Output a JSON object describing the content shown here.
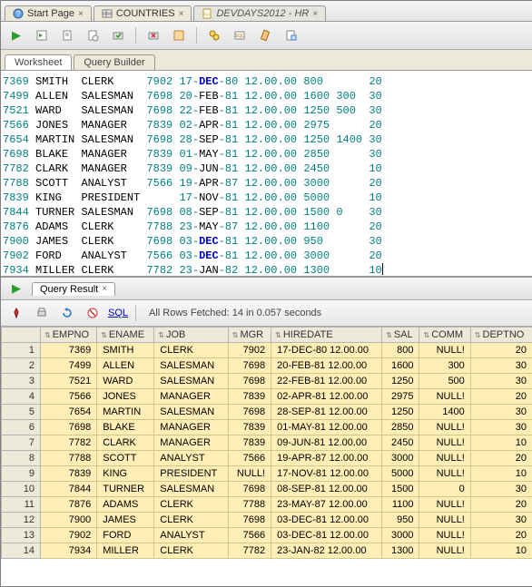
{
  "tabs": {
    "start": "Start Page",
    "countries": "COUNTRIES",
    "devdays": "DEVDAYS2012 - HR"
  },
  "sub_tabs": {
    "worksheet": "Worksheet",
    "query_builder": "Query Builder"
  },
  "editor_rows": [
    {
      "empno": "7369",
      "ename": "SMITH",
      "job": "CLERK",
      "mgr": "7902",
      "hiredate_pre": "17-",
      "hiredate_mon": "DEC",
      "hiredate_post": "-80",
      "time": "12.00.00",
      "sal": "800",
      "comm": "",
      "deptno": "20"
    },
    {
      "empno": "7499",
      "ename": "ALLEN",
      "job": "SALESMAN",
      "mgr": "7698",
      "hiredate_pre": "20-",
      "hiredate_mon": "FEB",
      "hiredate_post": "-81",
      "time": "12.00.00",
      "sal": "1600",
      "comm": "300",
      "deptno": "30"
    },
    {
      "empno": "7521",
      "ename": "WARD",
      "job": "SALESMAN",
      "mgr": "7698",
      "hiredate_pre": "22-",
      "hiredate_mon": "FEB",
      "hiredate_post": "-81",
      "time": "12.00.00",
      "sal": "1250",
      "comm": "500",
      "deptno": "30"
    },
    {
      "empno": "7566",
      "ename": "JONES",
      "job": "MANAGER",
      "mgr": "7839",
      "hiredate_pre": "02-",
      "hiredate_mon": "APR",
      "hiredate_post": "-81",
      "time": "12.00.00",
      "sal": "2975",
      "comm": "",
      "deptno": "20"
    },
    {
      "empno": "7654",
      "ename": "MARTIN",
      "job": "SALESMAN",
      "mgr": "7698",
      "hiredate_pre": "28-",
      "hiredate_mon": "SEP",
      "hiredate_post": "-81",
      "time": "12.00.00",
      "sal": "1250",
      "comm": "1400",
      "deptno": "30"
    },
    {
      "empno": "7698",
      "ename": "BLAKE",
      "job": "MANAGER",
      "mgr": "7839",
      "hiredate_pre": "01-",
      "hiredate_mon": "MAY",
      "hiredate_post": "-81",
      "time": "12.00.00",
      "sal": "2850",
      "comm": "",
      "deptno": "30"
    },
    {
      "empno": "7782",
      "ename": "CLARK",
      "job": "MANAGER",
      "mgr": "7839",
      "hiredate_pre": "09-",
      "hiredate_mon": "JUN",
      "hiredate_post": "-81",
      "time": "12.00.00",
      "sal": "2450",
      "comm": "",
      "deptno": "10"
    },
    {
      "empno": "7788",
      "ename": "SCOTT",
      "job": "ANALYST",
      "mgr": "7566",
      "hiredate_pre": "19-",
      "hiredate_mon": "APR",
      "hiredate_post": "-87",
      "time": "12.00.00",
      "sal": "3000",
      "comm": "",
      "deptno": "20"
    },
    {
      "empno": "7839",
      "ename": "KING",
      "job": "PRESIDENT",
      "mgr": "",
      "hiredate_pre": "17-",
      "hiredate_mon": "NOV",
      "hiredate_post": "-81",
      "time": "12.00.00",
      "sal": "5000",
      "comm": "",
      "deptno": "10"
    },
    {
      "empno": "7844",
      "ename": "TURNER",
      "job": "SALESMAN",
      "mgr": "7698",
      "hiredate_pre": "08-",
      "hiredate_mon": "SEP",
      "hiredate_post": "-81",
      "time": "12.00.00",
      "sal": "1500",
      "comm": "0",
      "deptno": "30"
    },
    {
      "empno": "7876",
      "ename": "ADAMS",
      "job": "CLERK",
      "mgr": "7788",
      "hiredate_pre": "23-",
      "hiredate_mon": "MAY",
      "hiredate_post": "-87",
      "time": "12.00.00",
      "sal": "1100",
      "comm": "",
      "deptno": "20"
    },
    {
      "empno": "7900",
      "ename": "JAMES",
      "job": "CLERK",
      "mgr": "7698",
      "hiredate_pre": "03-",
      "hiredate_mon": "DEC",
      "hiredate_post": "-81",
      "time": "12.00.00",
      "sal": "950",
      "comm": "",
      "deptno": "30"
    },
    {
      "empno": "7902",
      "ename": "FORD",
      "job": "ANALYST",
      "mgr": "7566",
      "hiredate_pre": "03-",
      "hiredate_mon": "DEC",
      "hiredate_post": "-81",
      "time": "12.00.00",
      "sal": "3000",
      "comm": "",
      "deptno": "20"
    },
    {
      "empno": "7934",
      "ename": "MILLER",
      "job": "CLERK",
      "mgr": "7782",
      "hiredate_pre": "23-",
      "hiredate_mon": "JAN",
      "hiredate_post": "-82",
      "time": "12.00.00",
      "sal": "1300",
      "comm": "",
      "deptno": "10"
    }
  ],
  "result_panel": {
    "title": "Query Result",
    "sql_link": "SQL",
    "status": "All Rows Fetched: 14 in 0.057 seconds"
  },
  "grid": {
    "headers": [
      "EMPNO",
      "ENAME",
      "JOB",
      "MGR",
      "HIREDATE",
      "SAL",
      "COMM",
      "DEPTNO"
    ],
    "rows": [
      {
        "n": 1,
        "empno": "7369",
        "ename": "SMITH",
        "job": "CLERK",
        "mgr": "7902",
        "hiredate": "17-DEC-80 12.00.00",
        "sal": "800",
        "comm": "NULL!",
        "deptno": "20"
      },
      {
        "n": 2,
        "empno": "7499",
        "ename": "ALLEN",
        "job": "SALESMAN",
        "mgr": "7698",
        "hiredate": "20-FEB-81 12.00.00",
        "sal": "1600",
        "comm": "300",
        "deptno": "30"
      },
      {
        "n": 3,
        "empno": "7521",
        "ename": "WARD",
        "job": "SALESMAN",
        "mgr": "7698",
        "hiredate": "22-FEB-81 12.00.00",
        "sal": "1250",
        "comm": "500",
        "deptno": "30"
      },
      {
        "n": 4,
        "empno": "7566",
        "ename": "JONES",
        "job": "MANAGER",
        "mgr": "7839",
        "hiredate": "02-APR-81 12.00.00",
        "sal": "2975",
        "comm": "NULL!",
        "deptno": "20"
      },
      {
        "n": 5,
        "empno": "7654",
        "ename": "MARTIN",
        "job": "SALESMAN",
        "mgr": "7698",
        "hiredate": "28-SEP-81 12.00.00",
        "sal": "1250",
        "comm": "1400",
        "deptno": "30"
      },
      {
        "n": 6,
        "empno": "7698",
        "ename": "BLAKE",
        "job": "MANAGER",
        "mgr": "7839",
        "hiredate": "01-MAY-81 12.00.00",
        "sal": "2850",
        "comm": "NULL!",
        "deptno": "30"
      },
      {
        "n": 7,
        "empno": "7782",
        "ename": "CLARK",
        "job": "MANAGER",
        "mgr": "7839",
        "hiredate": "09-JUN-81 12.00.00",
        "sal": "2450",
        "comm": "NULL!",
        "deptno": "10"
      },
      {
        "n": 8,
        "empno": "7788",
        "ename": "SCOTT",
        "job": "ANALYST",
        "mgr": "7566",
        "hiredate": "19-APR-87 12.00.00",
        "sal": "3000",
        "comm": "NULL!",
        "deptno": "20"
      },
      {
        "n": 9,
        "empno": "7839",
        "ename": "KING",
        "job": "PRESIDENT",
        "mgr": "NULL!",
        "hiredate": "17-NOV-81 12.00.00",
        "sal": "5000",
        "comm": "NULL!",
        "deptno": "10"
      },
      {
        "n": 10,
        "empno": "7844",
        "ename": "TURNER",
        "job": "SALESMAN",
        "mgr": "7698",
        "hiredate": "08-SEP-81 12.00.00",
        "sal": "1500",
        "comm": "0",
        "deptno": "30"
      },
      {
        "n": 11,
        "empno": "7876",
        "ename": "ADAMS",
        "job": "CLERK",
        "mgr": "7788",
        "hiredate": "23-MAY-87 12.00.00",
        "sal": "1100",
        "comm": "NULL!",
        "deptno": "20"
      },
      {
        "n": 12,
        "empno": "7900",
        "ename": "JAMES",
        "job": "CLERK",
        "mgr": "7698",
        "hiredate": "03-DEC-81 12.00.00",
        "sal": "950",
        "comm": "NULL!",
        "deptno": "30"
      },
      {
        "n": 13,
        "empno": "7902",
        "ename": "FORD",
        "job": "ANALYST",
        "mgr": "7566",
        "hiredate": "03-DEC-81 12.00.00",
        "sal": "3000",
        "comm": "NULL!",
        "deptno": "20"
      },
      {
        "n": 14,
        "empno": "7934",
        "ename": "MILLER",
        "job": "CLERK",
        "mgr": "7782",
        "hiredate": "23-JAN-82 12.00.00",
        "sal": "1300",
        "comm": "NULL!",
        "deptno": "10"
      }
    ]
  }
}
